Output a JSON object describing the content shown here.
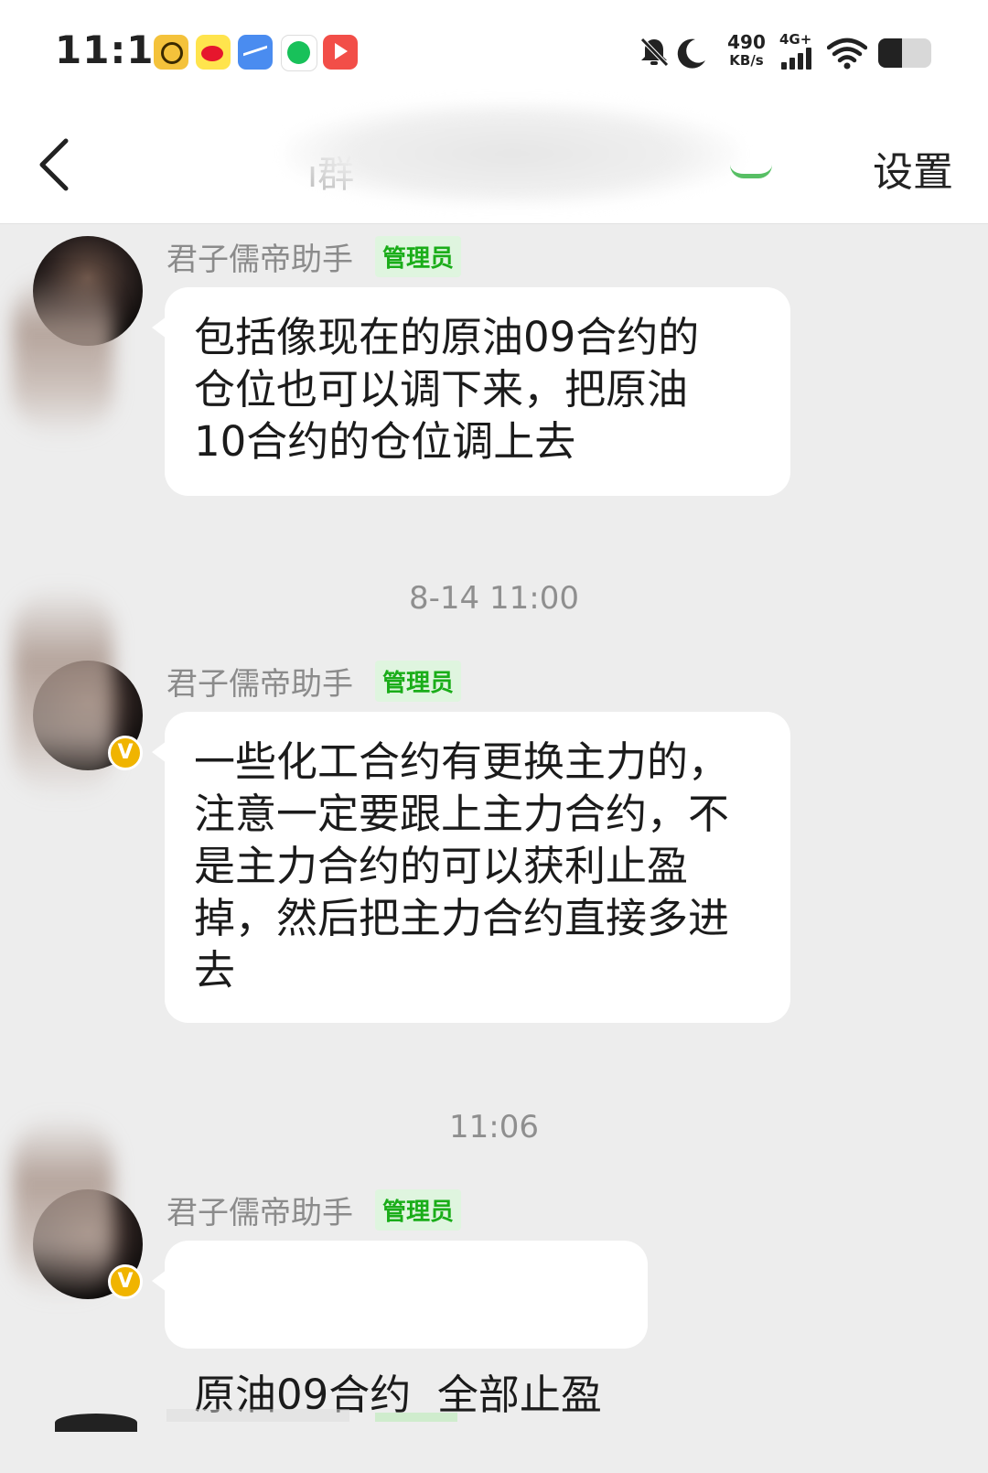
{
  "status_bar": {
    "time": "11:19",
    "net_speed_value": "490",
    "net_speed_unit": "KB/s",
    "network_type": "4G+",
    "app_icons": [
      "globe-icon",
      "weibo-icon",
      "stock-chart-icon",
      "green-pig-icon",
      "video-icon"
    ],
    "system_icons": [
      "bell-off-icon",
      "moon-icon",
      "signal-icon",
      "wifi-icon",
      "battery-icon"
    ],
    "battery_fraction": 0.45
  },
  "header": {
    "back_icon": "chevron-left-icon",
    "title_visible_fragment": "ı群",
    "settings_label": "设置"
  },
  "messages": [
    {
      "sender": "君子儒帝助手",
      "role": "管理员",
      "text_lines": [
        "包括像现在的原油09合约的",
        "仓位也可以调下来，把原油",
        "10合约的仓位调上去"
      ],
      "verified": false
    },
    {
      "timestamp": "8-14 11:00",
      "sender": "君子儒帝助手",
      "role": "管理员",
      "text_lines": [
        "一些化工合约有更换主力的，",
        "注意一定要跟上主力合约，不",
        "是主力合约的可以获利止盈",
        "掉，然后把主力合约直接多进",
        "去"
      ],
      "verified": true
    },
    {
      "timestamp": "11:06",
      "sender": "君子儒帝助手",
      "role": "管理员",
      "text_lines": [
        "原油09合约  全部止盈"
      ],
      "verified": true
    }
  ],
  "colors": {
    "chat_background": "#ededed",
    "bubble": "#ffffff",
    "admin_badge_text": "#1aad19",
    "admin_badge_bg": "#dff5df",
    "verified_badge": "#f0b400"
  }
}
